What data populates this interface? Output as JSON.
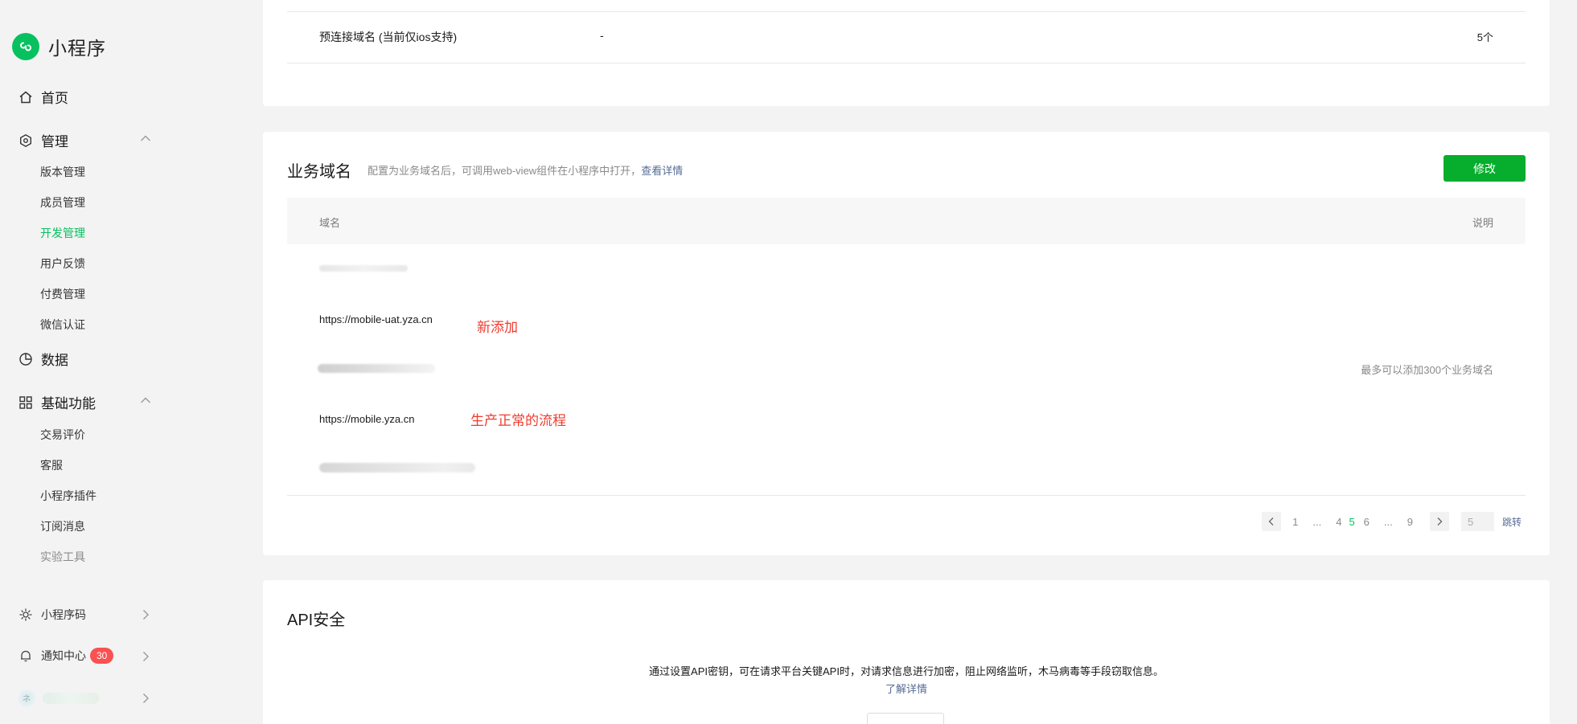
{
  "app": {
    "title": "小程序"
  },
  "sidebar": {
    "home": "首页",
    "manage": {
      "label": "管理",
      "items": [
        "版本管理",
        "成员管理",
        "开发管理",
        "用户反馈",
        "付费管理",
        "微信认证"
      ],
      "active": "开发管理"
    },
    "data": "数据",
    "basic": {
      "label": "基础功能",
      "items": [
        "交易评价",
        "客服",
        "小程序插件",
        "订阅消息",
        "实验工具"
      ]
    },
    "bottom": {
      "qrcode": "小程序码",
      "notify": "通知中心",
      "notify_count": "30",
      "account_initial": "ネ"
    }
  },
  "preconnect": {
    "label": "预连接域名 (当前仅ios支持)",
    "value": "-",
    "count": "5个"
  },
  "business_domain": {
    "title": "业务域名",
    "desc": "配置为业务域名后，可调用web-view组件在小程序中打开，",
    "desc_link": "查看详情",
    "edit_button": "修改",
    "col_domain": "域名",
    "col_note": "说明",
    "rows": [
      {
        "domain": "https://mobile-uat.yza.cn",
        "annotation": "新添加"
      },
      {
        "domain": "https://mobile.yza.cn",
        "annotation": "生产正常的流程"
      }
    ],
    "blurred_partials": [
      "https://m",
      "https://ap",
      "t.yza.cn"
    ],
    "limit_note": "最多可以添加300个业务域名",
    "pagination": {
      "pages": [
        "1",
        "...",
        "4",
        "5",
        "6",
        "...",
        "9"
      ],
      "current": "5",
      "jump_value": "5",
      "jump_label": "跳转"
    }
  },
  "api_security": {
    "title": "API安全",
    "desc": "通过设置API密钥，可在请求平台关键API时，对请求信息进行加密，阻止网络监听，木马病毒等手段窃取信息。",
    "link": "了解详情"
  },
  "colors": {
    "brand": "#07c160",
    "primary_button": "#07ad2c",
    "link": "#576b95",
    "annotation": "#f03b2e",
    "badge": "#fa5151"
  }
}
